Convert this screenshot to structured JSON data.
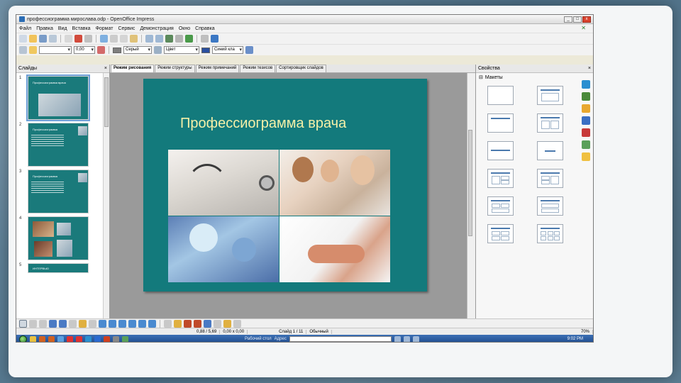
{
  "window": {
    "title": "профессиограмма мирослава.odp - OpenOffice Impress",
    "min_label": "_",
    "max_label": "□",
    "close_label": "x"
  },
  "menu": {
    "items": [
      "Файл",
      "Правка",
      "Вид",
      "Вставка",
      "Формат",
      "Сервис",
      "Демонстрация",
      "Окно",
      "Справка"
    ],
    "close_doc": "✕"
  },
  "toolbar": {
    "line_width": "0,00",
    "fill_color_name": "Серый",
    "fill_type": "Цвет",
    "line_color_name": "Синий кла"
  },
  "slides_panel": {
    "title": "Слайды",
    "close_label": "×",
    "slides": [
      {
        "num": "1",
        "title": "Профессиограмма врача"
      },
      {
        "num": "2",
        "title": "Профессиограмма"
      },
      {
        "num": "3",
        "title": "Профессиограмма"
      },
      {
        "num": "4",
        "title": ""
      },
      {
        "num": "5",
        "title": "ИНТЕРВЬЮ"
      }
    ]
  },
  "tabs": [
    "Режим рисования",
    "Режим структуры",
    "Режим примечаний",
    "Режим тезисов",
    "Сортировщик слайдов"
  ],
  "slide": {
    "title": "Профессиограмма врача"
  },
  "properties": {
    "title": "Свойства",
    "close_label": "×",
    "section": "Макеты"
  },
  "statusbar": {
    "position": "0,88 / 5,69",
    "size": "0,00 x 0,00",
    "slide": "Слайд 1 / 11",
    "layout": "Обычный",
    "zoom": "70%"
  },
  "taskbar": {
    "kb_label": "Рабочий стол",
    "address_label": "Адрес",
    "clock": "9:02 PM"
  },
  "colors": {
    "slide_bg": "#137a7c",
    "slide_title": "#f5f0a8",
    "accent": "#4a79ad"
  }
}
